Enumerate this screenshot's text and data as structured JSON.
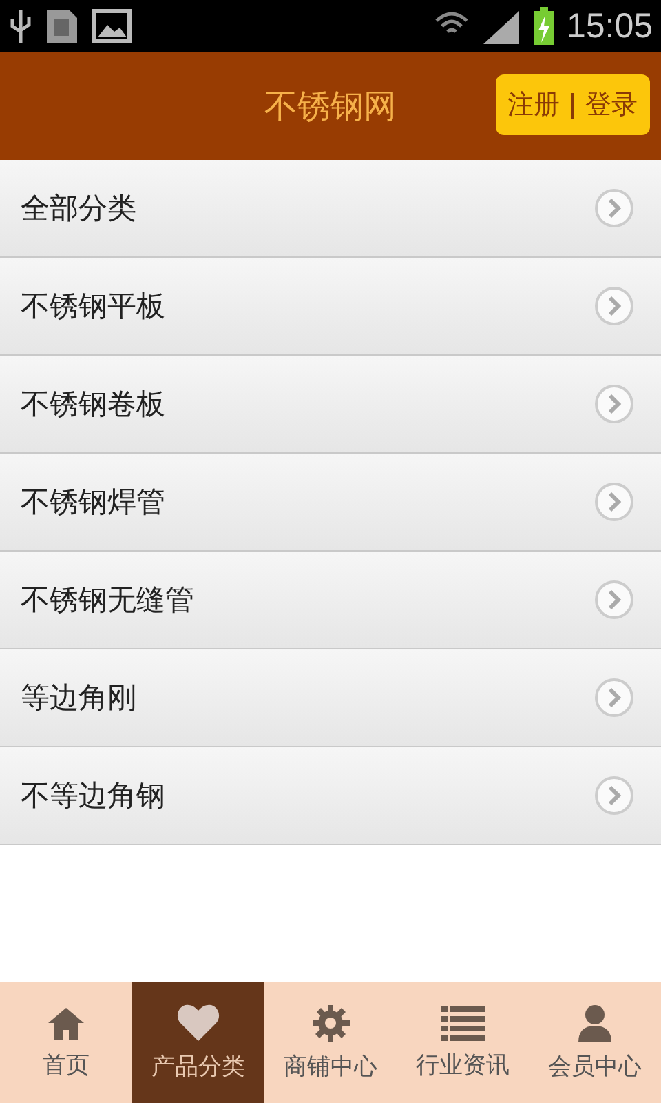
{
  "status_bar": {
    "time": "15:05"
  },
  "header": {
    "title": "不锈钢网",
    "auth_button": "注册 | 登录"
  },
  "categories": [
    {
      "label": "全部分类"
    },
    {
      "label": "不锈钢平板"
    },
    {
      "label": "不锈钢卷板"
    },
    {
      "label": "不锈钢焊管"
    },
    {
      "label": "不锈钢无缝管"
    },
    {
      "label": "等边角刚"
    },
    {
      "label": "不等边角钢"
    }
  ],
  "tabs": [
    {
      "label": "首页",
      "selected": false
    },
    {
      "label": "产品分类",
      "selected": true
    },
    {
      "label": "商铺中心",
      "selected": false
    },
    {
      "label": "行业资讯",
      "selected": false
    },
    {
      "label": "会员中心",
      "selected": false
    }
  ]
}
